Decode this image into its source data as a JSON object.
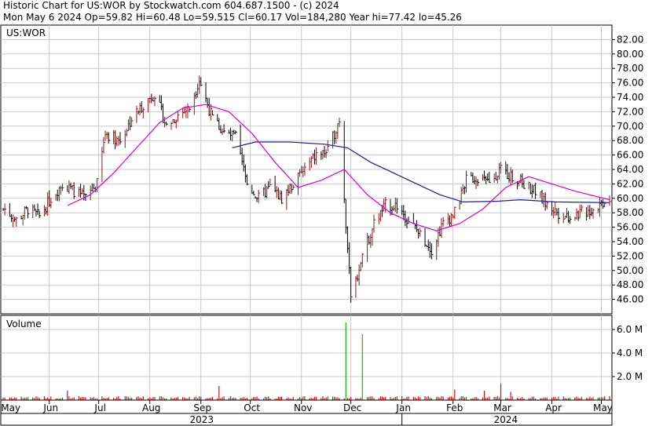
{
  "header": {
    "line1": "Historic Chart for US:WOR by Stockwatch.com 604.687.1500 - (c) 2024",
    "line2": "Mon May  6 2024   Op=59.82  Hi=60.48  Lo=59.515  Cl=60.17  Vol=184,280  Year hi=77.42  lo=45.26"
  },
  "colors": {
    "up_bar": "#8b1a1a",
    "down_bar": "#000000",
    "ma_short": "#d400d4",
    "ma_long": "#1a1aa6",
    "vol_normal": "#c0181a",
    "vol_up": "#22aa22",
    "grid": "#c8c8c8"
  },
  "chart_data": [
    {
      "type": "bar",
      "subtype": "ohlc",
      "title": "US:WOR",
      "ylim": [
        44,
        84
      ],
      "y_ticks": [
        "46.00",
        "48.00",
        "50.00",
        "52.00",
        "54.00",
        "56.00",
        "58.00",
        "60.00",
        "62.00",
        "64.00",
        "66.00",
        "68.00",
        "70.00",
        "72.00",
        "74.00",
        "76.00",
        "78.00",
        "80.00",
        "82.00"
      ],
      "grid": true,
      "approx_closes": [
        [
          "2023-05-05",
          58.5
        ],
        [
          "2023-05-12",
          57.0
        ],
        [
          "2023-05-19",
          58.5
        ],
        [
          "2023-05-26",
          57.5
        ],
        [
          "2023-06-02",
          60.0
        ],
        [
          "2023-06-09",
          62.0
        ],
        [
          "2023-06-16",
          61.0
        ],
        [
          "2023-06-23",
          60.0
        ],
        [
          "2023-06-30",
          62.0
        ],
        [
          "2023-07-05",
          69.0
        ],
        [
          "2023-07-14",
          68.0
        ],
        [
          "2023-07-21",
          71.0
        ],
        [
          "2023-07-28",
          73.0
        ],
        [
          "2023-08-04",
          74.5
        ],
        [
          "2023-08-11",
          70.0
        ],
        [
          "2023-08-18",
          71.5
        ],
        [
          "2023-08-25",
          72.5
        ],
        [
          "2023-08-31",
          76.5
        ],
        [
          "2023-09-08",
          71.0
        ],
        [
          "2023-09-15",
          69.0
        ],
        [
          "2023-09-22",
          68.5
        ],
        [
          "2023-09-29",
          62.0
        ],
        [
          "2023-10-06",
          60.0
        ],
        [
          "2023-10-13",
          61.5
        ],
        [
          "2023-10-20",
          60.0
        ],
        [
          "2023-10-27",
          62.0
        ],
        [
          "2023-11-03",
          64.0
        ],
        [
          "2023-11-10",
          66.0
        ],
        [
          "2023-11-17",
          66.5
        ],
        [
          "2023-11-24",
          71.0
        ],
        [
          "2023-12-01",
          46.0
        ],
        [
          "2023-12-08",
          52.0
        ],
        [
          "2023-12-15",
          56.5
        ],
        [
          "2023-12-22",
          59.0
        ],
        [
          "2023-12-29",
          59.0
        ],
        [
          "2024-01-05",
          57.0
        ],
        [
          "2024-01-12",
          55.0
        ],
        [
          "2024-01-19",
          53.0
        ],
        [
          "2024-01-26",
          56.5
        ],
        [
          "2024-02-02",
          58.0
        ],
        [
          "2024-02-09",
          62.5
        ],
        [
          "2024-02-16",
          63.0
        ],
        [
          "2024-02-23",
          62.0
        ],
        [
          "2024-02-29",
          64.0
        ],
        [
          "2024-03-08",
          63.0
        ],
        [
          "2024-03-15",
          62.0
        ],
        [
          "2024-03-22",
          61.0
        ],
        [
          "2024-03-29",
          59.0
        ],
        [
          "2024-04-05",
          58.0
        ],
        [
          "2024-04-12",
          57.5
        ],
        [
          "2024-04-19",
          58.0
        ],
        [
          "2024-04-26",
          58.5
        ],
        [
          "2024-05-06",
          60.17
        ]
      ],
      "ma_short": [
        [
          "2023-06-12",
          59.0
        ],
        [
          "2023-06-26",
          60.5
        ],
        [
          "2023-07-10",
          63.5
        ],
        [
          "2023-07-24",
          67.0
        ],
        [
          "2023-08-07",
          70.5
        ],
        [
          "2023-08-21",
          72.5
        ],
        [
          "2023-09-04",
          73.0
        ],
        [
          "2023-09-18",
          72.0
        ],
        [
          "2023-10-02",
          69.0
        ],
        [
          "2023-10-16",
          65.0
        ],
        [
          "2023-10-30",
          61.5
        ],
        [
          "2023-11-13",
          62.5
        ],
        [
          "2023-11-27",
          64.0
        ],
        [
          "2023-12-11",
          60.5
        ],
        [
          "2023-12-25",
          58.0
        ],
        [
          "2024-01-08",
          56.5
        ],
        [
          "2024-01-22",
          55.5
        ],
        [
          "2024-02-05",
          56.5
        ],
        [
          "2024-02-19",
          58.5
        ],
        [
          "2024-03-04",
          61.5
        ],
        [
          "2024-03-18",
          63.0
        ],
        [
          "2024-04-01",
          62.0
        ],
        [
          "2024-04-15",
          61.0
        ],
        [
          "2024-05-06",
          59.8
        ]
      ],
      "ma_long": [
        [
          "2023-09-20",
          67.0
        ],
        [
          "2023-10-04",
          67.8
        ],
        [
          "2023-10-25",
          67.8
        ],
        [
          "2023-11-15",
          67.5
        ],
        [
          "2023-11-29",
          67.0
        ],
        [
          "2023-12-13",
          65.0
        ],
        [
          "2023-12-27",
          63.5
        ],
        [
          "2024-01-10",
          62.0
        ],
        [
          "2024-01-24",
          60.5
        ],
        [
          "2024-02-07",
          59.5
        ],
        [
          "2024-02-28",
          59.6
        ],
        [
          "2024-03-13",
          59.8
        ],
        [
          "2024-04-03",
          59.5
        ],
        [
          "2024-05-06",
          59.4
        ]
      ]
    },
    {
      "type": "bar",
      "title": "Volume",
      "ylim": [
        0,
        7.2
      ],
      "y_ticks": [
        "2.0 M",
        "4.0 M",
        "6.0 M"
      ],
      "grid": true,
      "spikes": [
        [
          "2023-06-12",
          0.8
        ],
        [
          "2023-09-12",
          1.2
        ],
        [
          "2023-11-28",
          6.6
        ],
        [
          "2023-12-08",
          5.6
        ],
        [
          "2024-02-02",
          0.9
        ],
        [
          "2024-02-20",
          0.8
        ],
        [
          "2024-03-01",
          1.4
        ],
        [
          "2024-03-07",
          0.7
        ]
      ]
    }
  ],
  "x_axis": {
    "months": [
      {
        "label": "May",
        "date": "2023-05-01"
      },
      {
        "label": "Jun",
        "date": "2023-06-01"
      },
      {
        "label": "Jul",
        "date": "2023-07-01"
      },
      {
        "label": "Aug",
        "date": "2023-08-01"
      },
      {
        "label": "Sep",
        "date": "2023-09-01"
      },
      {
        "label": "Oct",
        "date": "2023-10-01"
      },
      {
        "label": "Nov",
        "date": "2023-11-01"
      },
      {
        "label": "Dec",
        "date": "2023-12-01"
      },
      {
        "label": "Jan",
        "date": "2024-01-01"
      },
      {
        "label": "Feb",
        "date": "2024-02-01"
      },
      {
        "label": "Mar",
        "date": "2024-03-01"
      },
      {
        "label": "Apr",
        "date": "2024-04-01"
      },
      {
        "label": "May",
        "date": "2024-05-01"
      }
    ],
    "years": [
      {
        "label": "2023",
        "from": "2023-05-04",
        "to": "2023-12-31"
      },
      {
        "label": "2024",
        "from": "2024-01-01",
        "to": "2024-05-06"
      }
    ],
    "range": [
      "2023-05-04",
      "2024-05-06"
    ]
  }
}
